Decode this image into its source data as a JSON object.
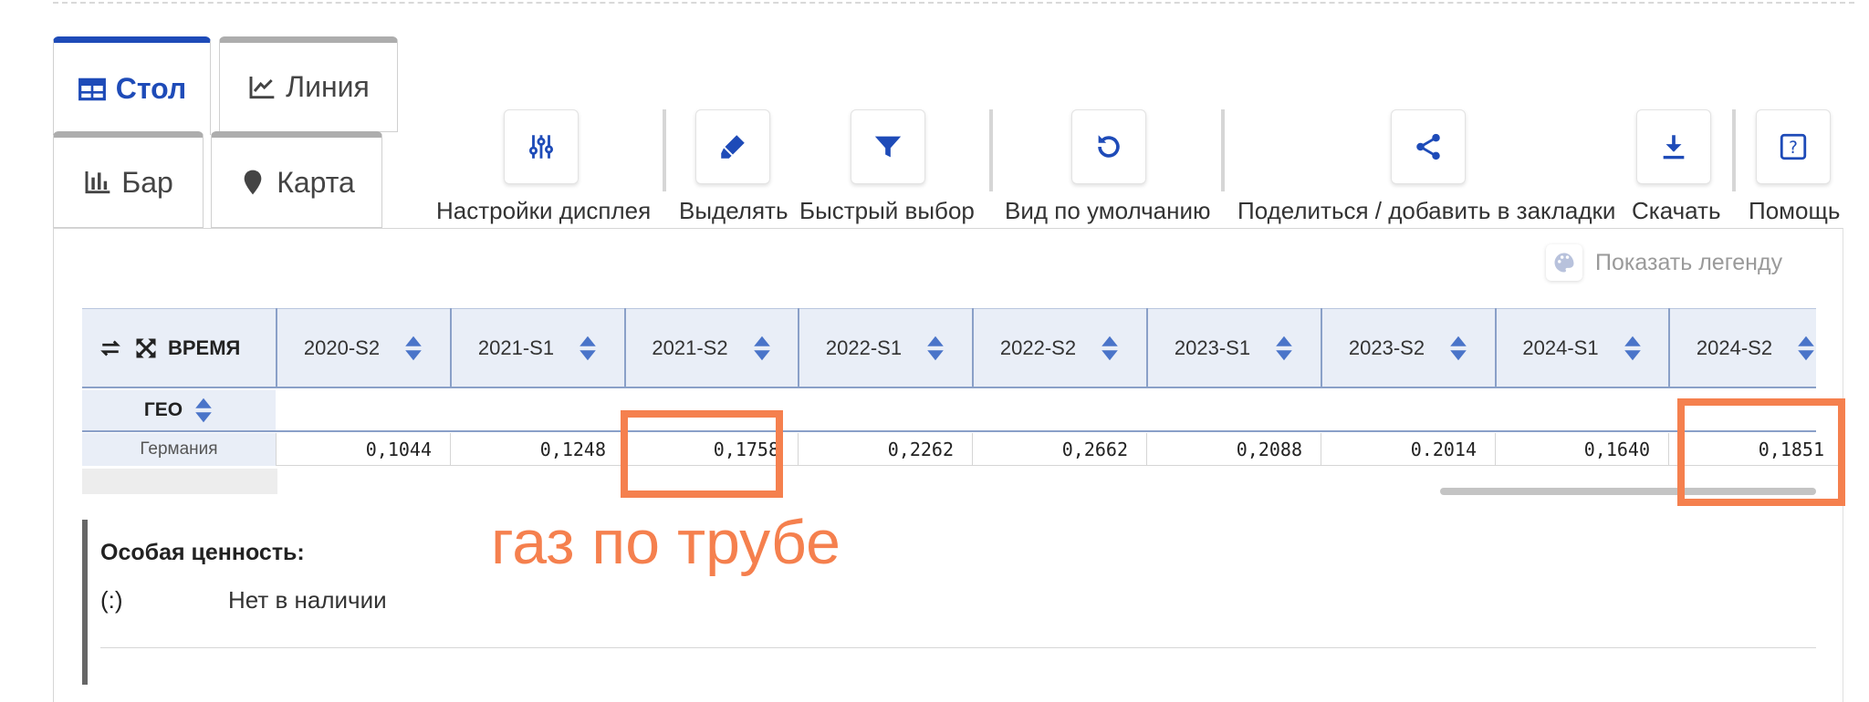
{
  "view_tabs": {
    "table": "Стол",
    "line": "Линия",
    "bar": "Бар",
    "map": "Карта"
  },
  "toolbar": {
    "display_settings": "Настройки дисплея",
    "highlight": "Выделять",
    "quick_select": "Быстрый выбор",
    "default_view": "Вид по умолчанию",
    "share": "Поделиться / добавить в закладки",
    "download": "Скачать",
    "help": "Помощь"
  },
  "legend": {
    "show_label": "Показать легенду"
  },
  "table": {
    "time_header": "ВРЕМЯ",
    "geo_header": "ГЕО",
    "columns": [
      "2020-S2",
      "2021-S1",
      "2021-S2",
      "2022-S1",
      "2022-S2",
      "2023-S1",
      "2023-S2",
      "2024-S1",
      "2024-S2"
    ],
    "rows": [
      {
        "label": "Германия",
        "values": [
          "0,1044",
          "0,1248",
          "0,1758",
          "0,2262",
          "0,2662",
          "0,2088",
          "0.2014",
          "0,1640",
          "0,1851"
        ]
      }
    ]
  },
  "annotation": "газ по трубе",
  "footnote": {
    "title": "Особая ценность:",
    "symbol": "(:)",
    "text": "Нет в наличии"
  },
  "colors": {
    "accent": "#1e4bb8",
    "highlight": "#f5804e",
    "header_bg": "#e9eef7"
  }
}
